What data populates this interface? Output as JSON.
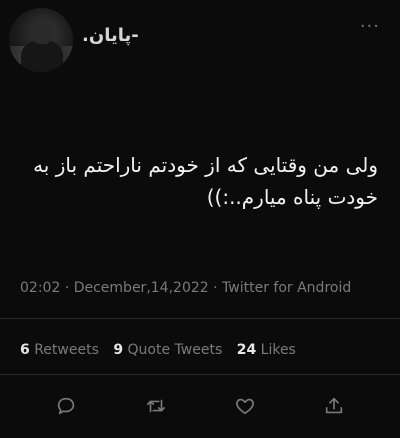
{
  "author": {
    "display_name": "-پایان."
  },
  "header": {
    "more_label": "···"
  },
  "tweet": {
    "text_line_1": "ولی من وقتایی که از خودتم ناراحتم باز به",
    "text_line_2": "خودت پناه میارم..:))",
    "time": "02:02",
    "separator": "·",
    "date": "December,14,2022",
    "source": "Twitter for Android"
  },
  "stats": {
    "retweets_count": "6",
    "retweets_label": "Retweets",
    "quotes_count": "9",
    "quotes_label": "Quote Tweets",
    "likes_count": "24",
    "likes_label": "Likes"
  },
  "actions": {
    "icons": [
      "reply-icon",
      "retweet-icon",
      "like-icon",
      "share-icon"
    ]
  },
  "colors": {
    "background": "#0b0b0b",
    "text": "#e7e7e7",
    "muted": "#7a7a7a",
    "divider": "#2a2a2a"
  }
}
